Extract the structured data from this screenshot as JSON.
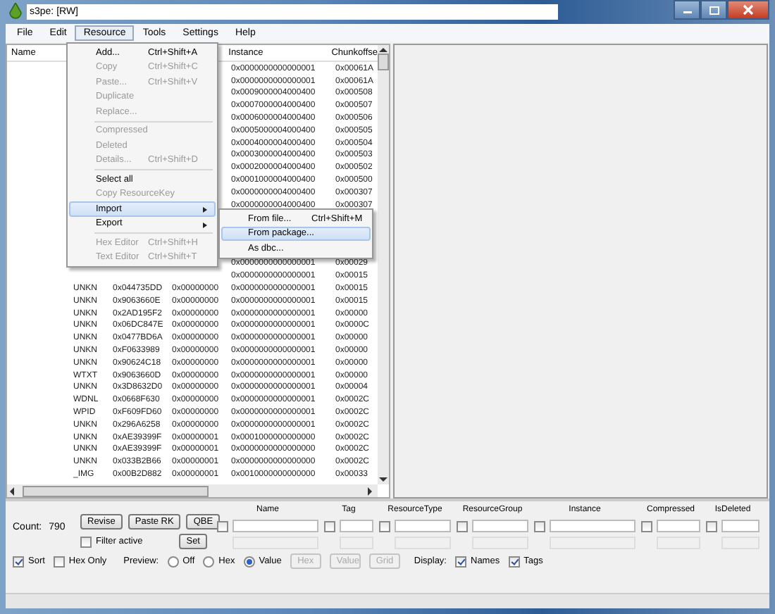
{
  "window": {
    "title": "s3pe: [RW]"
  },
  "menu_bar": [
    {
      "label": "File",
      "selected": false
    },
    {
      "label": "Edit",
      "selected": false
    },
    {
      "label": "Resource",
      "selected": true
    },
    {
      "label": "Tools",
      "selected": false
    },
    {
      "label": "Settings",
      "selected": false
    },
    {
      "label": "Help",
      "selected": false
    }
  ],
  "resource_menu": [
    {
      "kind": "item",
      "label": "Add...",
      "shortcut": "Ctrl+Shift+A",
      "disabled": false,
      "selected": false
    },
    {
      "kind": "item",
      "label": "Copy",
      "shortcut": "Ctrl+Shift+C",
      "disabled": true,
      "selected": false
    },
    {
      "kind": "item",
      "label": "Paste...",
      "shortcut": "Ctrl+Shift+V",
      "disabled": true,
      "selected": false
    },
    {
      "kind": "item",
      "label": "Duplicate",
      "disabled": true,
      "selected": false
    },
    {
      "kind": "item",
      "label": "Replace...",
      "disabled": true,
      "selected": false
    },
    {
      "kind": "separator"
    },
    {
      "kind": "item",
      "label": "Compressed",
      "disabled": true,
      "selected": false
    },
    {
      "kind": "item",
      "label": "Deleted",
      "disabled": true,
      "selected": false
    },
    {
      "kind": "item",
      "label": "Details...",
      "shortcut": "Ctrl+Shift+D",
      "disabled": true,
      "selected": false
    },
    {
      "kind": "separator"
    },
    {
      "kind": "item",
      "label": "Select all",
      "disabled": false,
      "selected": false
    },
    {
      "kind": "item",
      "label": "Copy ResourceKey",
      "disabled": true,
      "selected": false
    },
    {
      "kind": "submenu",
      "label": "Import",
      "disabled": false,
      "selected": true
    },
    {
      "kind": "submenu",
      "label": "Export",
      "disabled": false,
      "selected": false
    },
    {
      "kind": "separator"
    },
    {
      "kind": "item",
      "label": "Hex Editor",
      "shortcut": "Ctrl+Shift+H",
      "disabled": true,
      "selected": false
    },
    {
      "kind": "item",
      "label": "Text Editor",
      "shortcut": "Ctrl+Shift+T",
      "disabled": true,
      "selected": false
    }
  ],
  "import_submenu": [
    {
      "label": "From file...",
      "shortcut": "Ctrl+Shift+M",
      "selected": false
    },
    {
      "label": "From package...",
      "selected": true
    },
    {
      "label": "As dbc...",
      "selected": false
    }
  ],
  "table": {
    "columns": {
      "name": "Name",
      "instance": "Instance",
      "chunkoffset": "Chunkoffse"
    },
    "rows_upper": [
      {
        "instance": "0x0000000000000001",
        "chunkoffset": "0x00061A"
      },
      {
        "instance": "0x0000000000000001",
        "chunkoffset": "0x00061A"
      },
      {
        "instance": "0x0009000004000400",
        "chunkoffset": "0x000508"
      },
      {
        "instance": "0x0007000004000400",
        "chunkoffset": "0x000507"
      },
      {
        "instance": "0x0006000004000400",
        "chunkoffset": "0x000506"
      },
      {
        "instance": "0x0005000004000400",
        "chunkoffset": "0x000505"
      },
      {
        "instance": "0x0004000004000400",
        "chunkoffset": "0x000504"
      },
      {
        "instance": "0x0003000004000400",
        "chunkoffset": "0x000503"
      },
      {
        "instance": "0x0002000004000400",
        "chunkoffset": "0x000502"
      },
      {
        "instance": "0x0001000004000400",
        "chunkoffset": "0x000500"
      },
      {
        "instance": "0x0000000004000400",
        "chunkoffset": "0x000307"
      },
      {
        "instance": "0x0000000004000400",
        "chunkoffset": "0x000307"
      }
    ],
    "rows_lower": [
      {
        "instance": "0x0000000000000001",
        "chunkoffset": "0x00029"
      },
      {
        "instance": "0x0000000000000001",
        "chunkoffset": "0x00015"
      },
      {
        "column_2": "UNKN",
        "column_3": "0x044735DD",
        "column_4": "0x00000000",
        "instance": "0x0000000000000001",
        "chunkoffset": "0x00015"
      },
      {
        "column_2": "UNKN",
        "column_3": "0x9063660E",
        "column_4": "0x00000000",
        "instance": "0x0000000000000001",
        "chunkoffset": "0x00015"
      },
      {
        "column_2": "UNKN",
        "column_3": "0x2AD195F2",
        "column_4": "0x00000000",
        "instance": "0x0000000000000001",
        "chunkoffset": "0x00000"
      },
      {
        "column_2": "UNKN",
        "column_3": "0x06DC847E",
        "column_4": "0x00000000",
        "instance": "0x0000000000000001",
        "chunkoffset": "0x0000C"
      },
      {
        "column_2": "UNKN",
        "column_3": "0x0477BD6A",
        "column_4": "0x00000000",
        "instance": "0x0000000000000001",
        "chunkoffset": "0x00000"
      },
      {
        "column_2": "UNKN",
        "column_3": "0xF0633989",
        "column_4": "0x00000000",
        "instance": "0x0000000000000001",
        "chunkoffset": "0x00000"
      },
      {
        "column_2": "UNKN",
        "column_3": "0x90624C18",
        "column_4": "0x00000000",
        "instance": "0x0000000000000001",
        "chunkoffset": "0x00000"
      },
      {
        "column_2": "WTXT",
        "column_3": "0x9063660D",
        "column_4": "0x00000000",
        "instance": "0x0000000000000001",
        "chunkoffset": "0x00000"
      },
      {
        "column_2": "UNKN",
        "column_3": "0x3D8632D0",
        "column_4": "0x00000000",
        "instance": "0x0000000000000001",
        "chunkoffset": "0x00004"
      },
      {
        "column_2": "WDNL",
        "column_3": "0x0668F630",
        "column_4": "0x00000000",
        "instance": "0x0000000000000001",
        "chunkoffset": "0x0002C"
      },
      {
        "column_2": "WPID",
        "column_3": "0xF609FD60",
        "column_4": "0x00000000",
        "instance": "0x0000000000000001",
        "chunkoffset": "0x0002C"
      },
      {
        "column_2": "UNKN",
        "column_3": "0x296A6258",
        "column_4": "0x00000000",
        "instance": "0x0000000000000001",
        "chunkoffset": "0x0002C"
      },
      {
        "column_2": "UNKN",
        "column_3": "0xAE39399F",
        "column_4": "0x00000001",
        "instance": "0x0001000000000000",
        "chunkoffset": "0x0002C"
      },
      {
        "column_2": "UNKN",
        "column_3": "0xAE39399F",
        "column_4": "0x00000001",
        "instance": "0x0000000000000000",
        "chunkoffset": "0x0002C"
      },
      {
        "column_2": "UNKN",
        "column_3": "0x033B2B66",
        "column_4": "0x00000001",
        "instance": "0x0000000000000000",
        "chunkoffset": "0x0002C"
      },
      {
        "column_2": "_IMG",
        "column_3": "0x00B2D882",
        "column_4": "0x00000001",
        "instance": "0x0010000000000000",
        "chunkoffset": "0x00033"
      }
    ]
  },
  "count": {
    "label": "Count:",
    "value": "790"
  },
  "buttons": [
    "Revise",
    "Paste RK",
    "QBE"
  ],
  "filter_active": {
    "label": "Filter active",
    "checked": false
  },
  "set_button": "Set",
  "filters": [
    {
      "label": "Name",
      "checked": false
    },
    {
      "label": "Tag",
      "checked": false
    },
    {
      "label": "ResourceType",
      "checked": false
    },
    {
      "label": "ResourceGroup",
      "checked": false
    },
    {
      "label": "Instance",
      "checked": false
    },
    {
      "label": "Compressed",
      "checked": false
    },
    {
      "label": "IsDeleted",
      "checked": false
    }
  ],
  "sort": {
    "label": "Sort",
    "checked": true
  },
  "hex_only": {
    "label": "Hex Only",
    "checked": false
  },
  "preview": {
    "label": "Preview:",
    "options": [
      {
        "label": "Off",
        "selected": false
      },
      {
        "label": "Hex",
        "selected": false
      },
      {
        "label": "Value",
        "selected": true
      }
    ]
  },
  "preview_buttons": [
    {
      "label": "Hex",
      "disabled": true
    },
    {
      "label": "Value",
      "disabled": true
    },
    {
      "label": "Grid",
      "disabled": true
    }
  ],
  "display": {
    "label": "Display:",
    "options": [
      {
        "label": "Names",
        "checked": true
      },
      {
        "label": "Tags",
        "checked": true
      }
    ]
  }
}
